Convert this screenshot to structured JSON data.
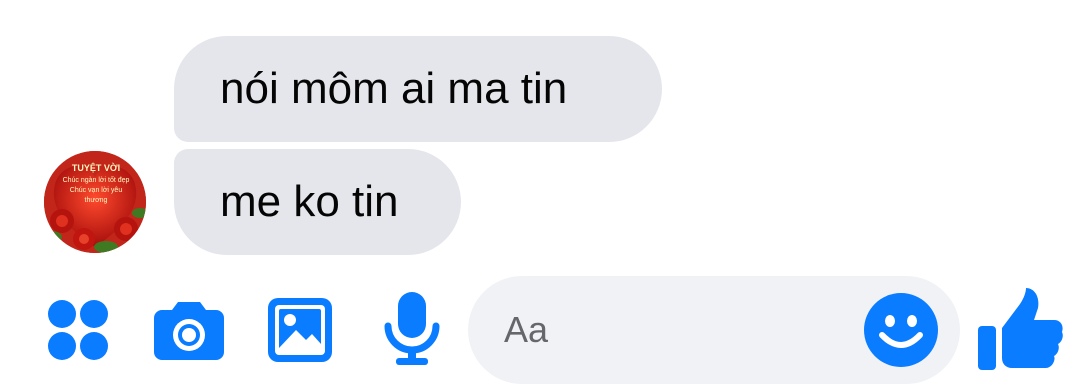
{
  "conversation": {
    "messages": [
      {
        "sender": "contact",
        "text": "nói môm ai ma tin"
      },
      {
        "sender": "contact",
        "text": "me ko tin"
      }
    ],
    "avatar": {
      "lines": [
        "TUYỆT VỜI",
        "Chúc ngàn lời tốt đẹp",
        "Chúc vạn lời yêu",
        "thương"
      ]
    }
  },
  "composer": {
    "placeholder": "Aa",
    "icons": {
      "more": "apps-grid-icon",
      "camera": "camera-icon",
      "gallery": "image-icon",
      "voice": "microphone-icon",
      "emoji": "smiley-icon",
      "like": "thumbs-up-icon"
    }
  },
  "colors": {
    "accent": "#0a7cff",
    "bubble": "#e4e6eb",
    "input": "#f0f2f5",
    "text": "#050505",
    "placeholder": "#65676b"
  }
}
